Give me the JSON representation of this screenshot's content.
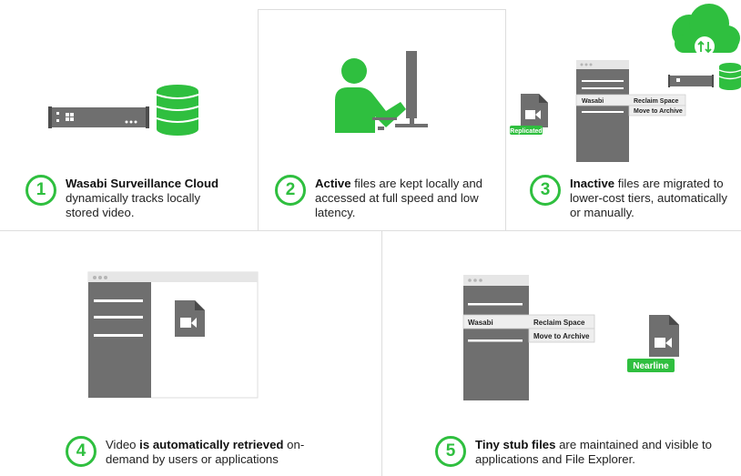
{
  "steps": [
    {
      "number": "1",
      "bold": "Wasabi Surveillance Cloud",
      "text": "dynamically tracks locally stored video."
    },
    {
      "number": "2",
      "bold": "Active",
      "text": " files are kept locally and accessed at full speed and low latency."
    },
    {
      "number": "3",
      "bold": "Inactive",
      "text": " files are migrated to lower-cost tiers, automatically or manually."
    },
    {
      "number": "4",
      "pre": "Video ",
      "bold": "is automatically retrieved",
      "text": " on-demand by users or applications"
    },
    {
      "number": "5",
      "bold": "Tiny stub files",
      "text": " are maintained and visible to applications and File Explorer."
    }
  ],
  "menu": {
    "wasabi": "Wasabi",
    "reclaim": "Reclaim Space",
    "archive": "Move to Archive"
  },
  "badges": {
    "replicated": "Replicated",
    "nearline": "Nearline"
  },
  "colors": {
    "accent": "#2fbf3f",
    "gray": "#6f6f6f",
    "light": "#e6e6e6"
  }
}
